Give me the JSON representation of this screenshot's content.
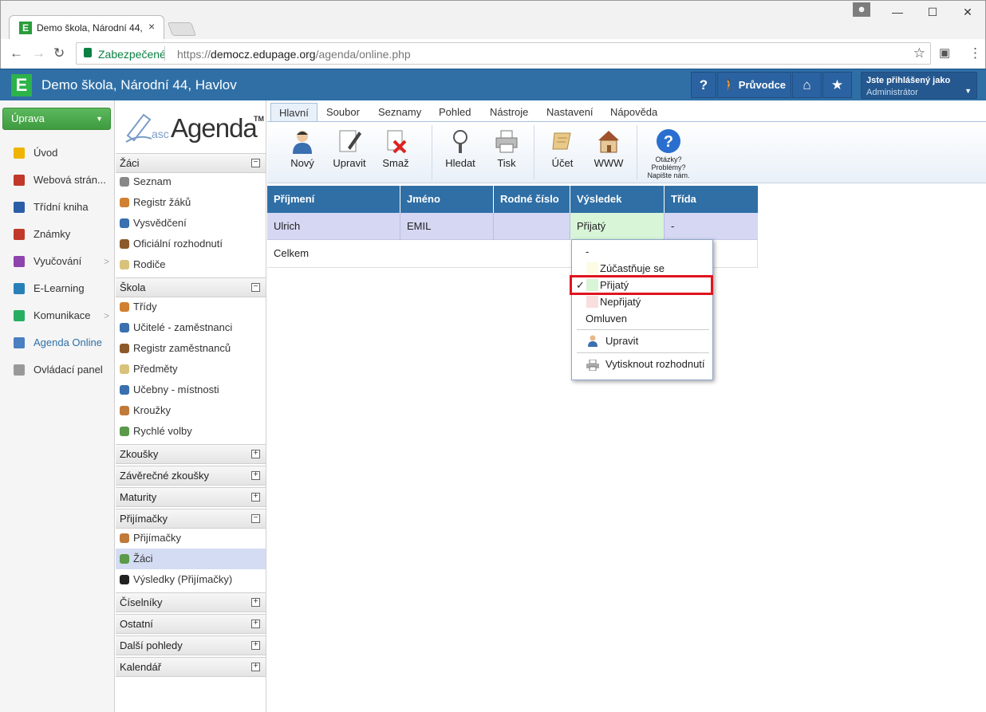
{
  "browser": {
    "tab_title": "Demo škola, Národní 44,",
    "tab_close": "×",
    "security_label": "Zabezpečené",
    "url_scheme": "https://",
    "url_domain": "democz.edupage.org",
    "url_path": "/agenda/online.php",
    "win_min": "—",
    "win_max": "☐",
    "win_close": "✕"
  },
  "header": {
    "logo": "E",
    "title": "Demo škola, Národní 44, Havlov",
    "help_label": "?",
    "guide_label": "Průvodce",
    "user_line1": "Jste přihlášený jako",
    "user_line2": "Administrátor"
  },
  "main_menu": {
    "uprava_label": "Úprava",
    "items": [
      {
        "label": "Úvod",
        "icon": "star-icon",
        "color": "#f0b400",
        "arrow": ""
      },
      {
        "label": "Webová strán...",
        "icon": "web-icon",
        "color": "#c0392b",
        "arrow": ""
      },
      {
        "label": "Třídní kniha",
        "icon": "book-icon",
        "color": "#2c5ea8",
        "arrow": ""
      },
      {
        "label": "Známky",
        "icon": "grades-icon",
        "color": "#c0392b",
        "arrow": ""
      },
      {
        "label": "Vyučování",
        "icon": "teaching-icon",
        "color": "#8e44ad",
        "arrow": ">"
      },
      {
        "label": "E-Learning",
        "icon": "elearning-icon",
        "color": "#2980b9",
        "arrow": ""
      },
      {
        "label": "Komunikace",
        "icon": "communication-icon",
        "color": "#27ae60",
        "arrow": ">"
      },
      {
        "label": "Agenda Online",
        "icon": "agenda-icon",
        "color": "#4a7fc1",
        "arrow": ""
      },
      {
        "label": "Ovládací panel",
        "icon": "settings-icon",
        "color": "#999999",
        "arrow": ""
      }
    ]
  },
  "agenda": {
    "logo_prefix": "asc",
    "logo_main": "Agenda",
    "logo_tm": "TM",
    "sections": {
      "zaci": "Žáci",
      "skola": "Škola",
      "zkousky": "Zkoušky",
      "zaverecne": "Závěrečné zkoušky",
      "maturity": "Maturity",
      "prijimacky": "Přijímačky",
      "ciselniky": "Číselníky",
      "ostatni": "Ostatní",
      "dalsi": "Další pohledy",
      "kalendar": "Kalendář"
    },
    "zaci_items": [
      "Seznam",
      "Registr žáků",
      "Vysvědčení",
      "Oficiální rozhodnutí",
      "Rodiče"
    ],
    "skola_items": [
      "Třídy",
      "Učitelé - zaměstnanci",
      "Registr zaměstnanců",
      "Předměty",
      "Učebny - místnosti",
      "Kroužky",
      "Rychlé volby"
    ],
    "prijimacky_items": [
      "Přijímačky",
      "Žáci",
      "Výsledky (Přijímačky)"
    ],
    "expand": "+",
    "collapse": "−"
  },
  "ribbon": {
    "tabs": [
      "Hlavní",
      "Soubor",
      "Seznamy",
      "Pohled",
      "Nástroje",
      "Nastavení",
      "Nápověda"
    ],
    "buttons": [
      "Nový",
      "Upravit",
      "Smaž",
      "Hledat",
      "Tisk",
      "Účet",
      "WWW"
    ],
    "help_lines": [
      "Otázky?",
      "Problémy?",
      "Napište nám."
    ]
  },
  "grid": {
    "columns": [
      "Příjmení",
      "Jméno",
      "Rodné číslo",
      "Výsledek",
      "Třída"
    ],
    "row": [
      "Ulrich",
      "EMIL",
      "",
      "Přijatý",
      "-"
    ],
    "total_label": "Celkem"
  },
  "dropdown": {
    "items": [
      {
        "label": "-",
        "color": ""
      },
      {
        "label": "Zúčastňuje se",
        "color": "#fdfbe3"
      },
      {
        "label": "Přijatý",
        "color": "#d8f5d8"
      },
      {
        "label": "Nepřijatý",
        "color": "#f9dede"
      },
      {
        "label": "Omluven",
        "color": ""
      }
    ],
    "check": "✓",
    "edit_label": "Upravit",
    "print_label": "Vytisknout rozhodnutí"
  }
}
